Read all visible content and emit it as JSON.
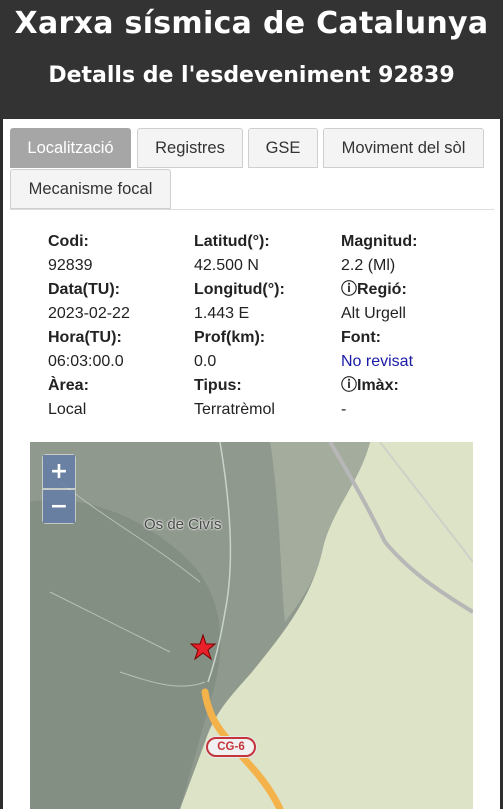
{
  "header": {
    "site_title": "Xarxa sísmica de Catalunya",
    "event_title": "Detalls de l'esdeveniment 92839"
  },
  "tabs": [
    {
      "label": "Localització",
      "active": true
    },
    {
      "label": "Registres",
      "active": false
    },
    {
      "label": "GSE",
      "active": false
    },
    {
      "label": "Moviment del sòl",
      "active": false
    },
    {
      "label": "Mecanisme focal",
      "active": false
    }
  ],
  "details": {
    "codi": {
      "label": "Codi:",
      "value": "92839"
    },
    "latitud": {
      "label": "Latitud(°):",
      "value": "42.500 N"
    },
    "magnitud": {
      "label": "Magnitud:",
      "value": "2.2 (Ml)"
    },
    "data": {
      "label": "Data(TU):",
      "value": "2023-02-22"
    },
    "longitud": {
      "label": "Longitud(°):",
      "value": "1.443 E"
    },
    "regio": {
      "label": "ⓘRegió:",
      "value": "Alt Urgell"
    },
    "hora": {
      "label": "Hora(TU):",
      "value": "06:03:00.0"
    },
    "prof": {
      "label": "Prof(km):",
      "value": "0.0"
    },
    "font": {
      "label": "Font:",
      "value": "No revisat"
    },
    "area": {
      "label": "Àrea:",
      "value": "Local"
    },
    "tipus": {
      "label": "Tipus:",
      "value": "Terratrèmol"
    },
    "imax": {
      "label": "ⓘImàx:",
      "value": "-"
    }
  },
  "map": {
    "zoom_in": "+",
    "zoom_out": "−",
    "place_label": "Os de Civís",
    "road_label": "CG-6",
    "epicenter_color": "#e8202a",
    "road_color": "#f3b24a"
  }
}
